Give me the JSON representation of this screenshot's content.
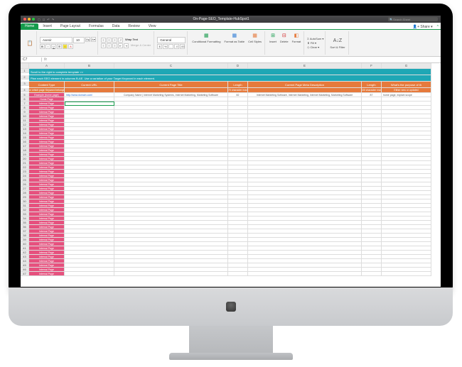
{
  "titlebar": {
    "filename": "On-Page-SEO_Template-HubSpot1",
    "search_placeholder": "Search Sheet"
  },
  "ribbon": {
    "tabs": [
      "Home",
      "Insert",
      "Page Layout",
      "Formulas",
      "Data",
      "Review",
      "View"
    ],
    "share_label": "Share",
    "font_name": "Avenir",
    "font_size": "10",
    "wrap_label": "Wrap Text",
    "merge_label": "Merge & Center",
    "num_format": "General",
    "cond_format": "Conditional Formatting",
    "fmt_table": "Format as Table",
    "cell_styles": "Cell Styles",
    "insert": "Insert",
    "delete": "Delete",
    "format": "Format",
    "autosum": "AutoSum",
    "fill": "Fill",
    "clear": "Clear",
    "sortfilter": "Sort & Filter"
  },
  "fxbar": {
    "cell": "C7",
    "fx_label": "fx"
  },
  "sheet": {
    "col_letters": [
      "",
      "A",
      "B",
      "C",
      "D",
      "E",
      "F",
      "G"
    ],
    "banner1": "Scroll to the right to complete template >>",
    "banner2": "Plan each SEO element in columns B-AE. Use a variation of your Target Keyword in each element.",
    "headers": {
      "content_type": "Content Type",
      "current_url": "Current URL",
      "page_title": "Current Page Title",
      "length1": "Length",
      "meta_desc": "Current Page Meta Description",
      "length2": "Length",
      "purpose": "What's the purpose of th"
    },
    "subheaders": {
      "sub1": "on which page Keyword belongs",
      "sub2": "",
      "sub3": "",
      "sub4": "70 character max",
      "sub5": "",
      "sub6": "100 character max",
      "sub7": "Either new or updated"
    },
    "example_row": {
      "type": "Example (home page)",
      "url": "http://www.domain.com/",
      "title": "Company Name | Internet Marketing Systems, Internet Marketing, Marketing Software",
      "len1": "82",
      "meta": "Internet Marketing Software, Internet Marketing, Internet Marketing, Marketing Software",
      "len2": "87",
      "purpose": "home page, explain scope"
    },
    "row_types": [
      "Home Page",
      "Internal Page",
      "Internal Page",
      "Internal Page",
      "Internal Page",
      "Internal Page",
      "Internal Page",
      "Internal Page",
      "Internal Page",
      "Internal Page",
      "Internal Page",
      "Internal Page",
      "Internal Page",
      "Internal Page",
      "Internal Page",
      "Internal Page",
      "Internal Page",
      "Internal Page",
      "Internal Page",
      "Internal Page",
      "Internal Page",
      "Internal Page",
      "Internal Page",
      "Internal Page",
      "Internal Page",
      "Internal Page",
      "Internal Page",
      "Internal Page",
      "Internal Page",
      "Internal Page",
      "Internal Page",
      "Internal Page",
      "Internal Page",
      "Internal Page",
      "Internal Page",
      "Internal Page",
      "Internal Page",
      "Internal Page",
      "Internal Page",
      "Internal Page",
      "Internal Page",
      "Internal Page"
    ]
  }
}
